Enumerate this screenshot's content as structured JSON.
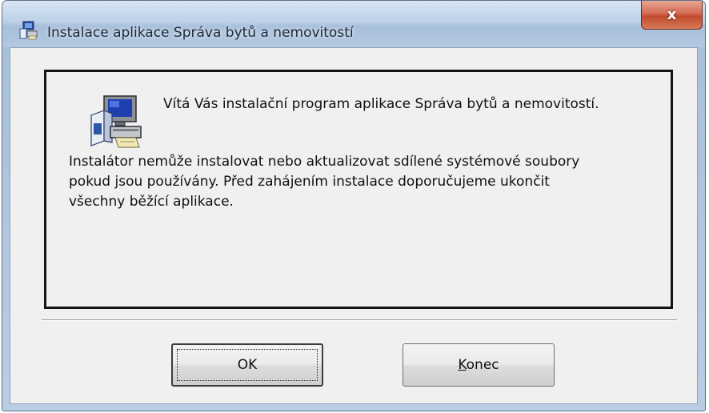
{
  "window": {
    "title": "Instalace aplikace Správa bytů a nemovitostí",
    "close_glyph": "x"
  },
  "content": {
    "welcome": "Vítá Vás instalační program aplikace Správa bytů a nemovitostí.",
    "info_lines": [
      "Instalátor nemůže instalovat nebo aktualizovat sdílené systémové soubory",
      "pokud jsou používány. Před zahájením instalace doporučujeme ukončit",
      "všechny běžící aplikace."
    ]
  },
  "buttons": {
    "ok_label": "OK",
    "konec_label": "Konec"
  },
  "icons": {
    "title": "installer-app-icon",
    "main": "computer-setup-icon"
  },
  "colors": {
    "close_red": "#c24a2e",
    "panel_border": "#141414",
    "client_bg": "#f0f0f0"
  }
}
